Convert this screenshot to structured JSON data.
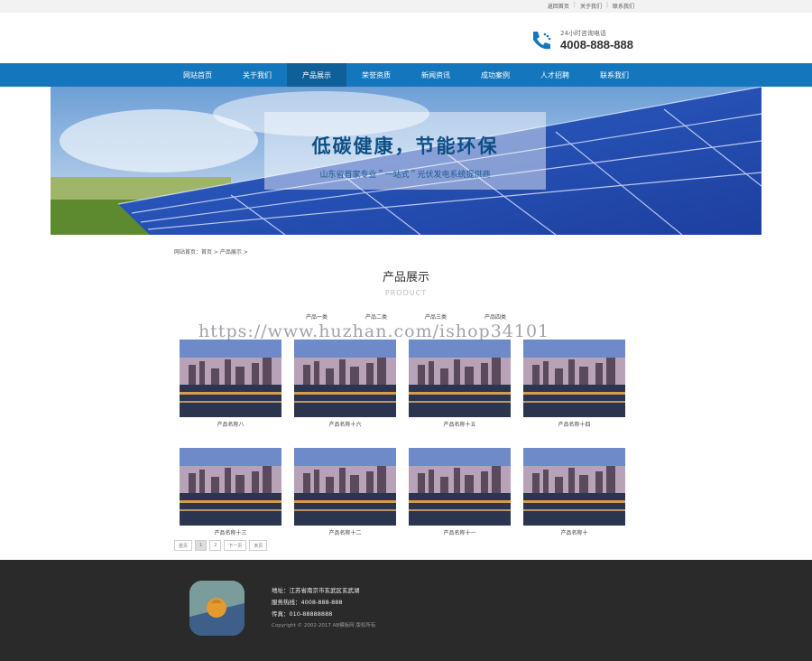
{
  "topbar": {
    "links": [
      "返回首页",
      "关于我们",
      "联系我们"
    ]
  },
  "hotline": {
    "label": "24小时咨询电话",
    "number": "4008-888-888"
  },
  "nav": {
    "items": [
      "网站首页",
      "关于我们",
      "产品展示",
      "荣誉资质",
      "新闻资讯",
      "成功案例",
      "人才招聘",
      "联系我们"
    ],
    "active": "产品展示"
  },
  "banner": {
    "title": "低碳健康，节能环保",
    "subtitle": "山东省首家专业＂一站式＂光伏发电系统提供商"
  },
  "breadcrumb": "网站首页：首页 > 产品展示 >",
  "section": {
    "title": "产品展示",
    "subtitle": "PRODUCT"
  },
  "categories": [
    "产品一类",
    "产品二类",
    "产品三类",
    "产品四类"
  ],
  "watermark": "https://www.huzhan.com/ishop34101",
  "products": [
    "产品名称八",
    "产品名称十六",
    "产品名称十五",
    "产品名称十四",
    "产品名称十三",
    "产品名称十二",
    "产品名称十一",
    "产品名称十"
  ],
  "pager": {
    "first": "首页",
    "p1": "1",
    "p2": "2",
    "next": "下一页",
    "last": "末页"
  },
  "footer": {
    "address": "地址：江苏省南京市玄武区玄武湖",
    "phone": "服务热线：4008-888-888",
    "fax": "传真：010-88888888",
    "copyright": "Copyright © 2002-2017 AB模板网 版权所有"
  },
  "colors": {
    "nav": "#1477be",
    "footer": "#2a2a2a"
  }
}
